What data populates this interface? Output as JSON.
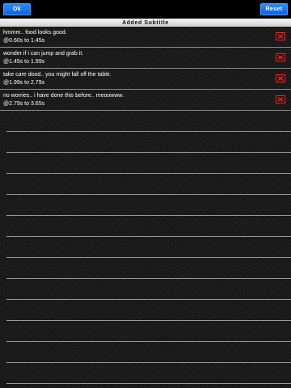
{
  "toolbar": {
    "ok_label": "Ok",
    "reset_label": "Reset",
    "accent_color": "#1a73ef"
  },
  "section": {
    "title": "Added Subtitle"
  },
  "subtitles": [
    {
      "text": "hmmm.. food looks good.",
      "timing": "@0.60s to 1.45s"
    },
    {
      "text": "wonder if i can jump and grab it.",
      "timing": "@1.45s to 1.99s"
    },
    {
      "text": "take care dood.. you might fall off the table.",
      "timing": "@1.99s to 2.79s"
    },
    {
      "text": "no worries.. i have done this before.. meoowww.",
      "timing": "@2.79s to 3.65s"
    }
  ],
  "delete_icon": "close-x-icon",
  "delete_color": "#e0322f"
}
